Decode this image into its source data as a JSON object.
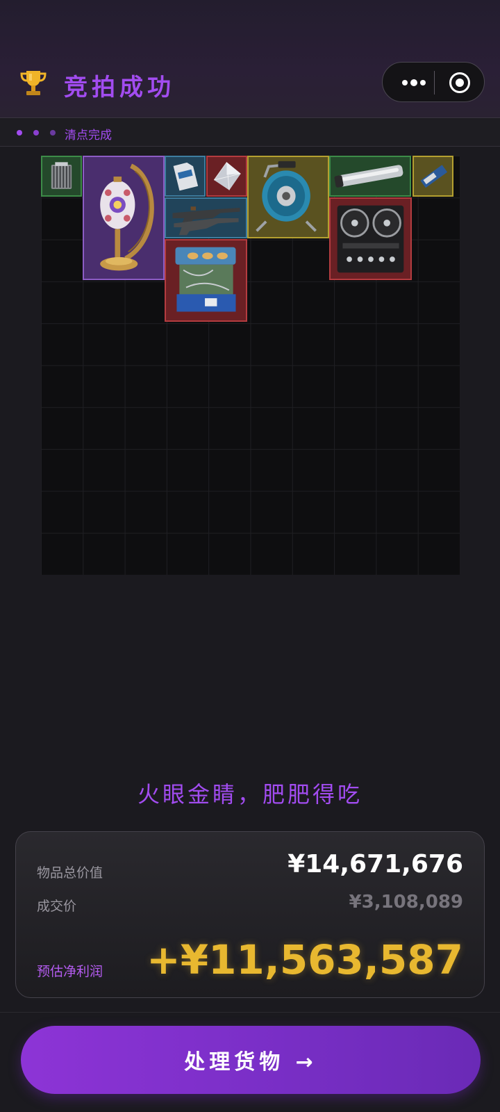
{
  "header": {
    "title": "竞拍成功",
    "trophy_icon": "trophy-icon",
    "more_icon": "more-dots-icon",
    "close_icon": "target-circle-icon"
  },
  "status": {
    "text": "清点完成"
  },
  "slogan": "火眼金睛，肥肥得吃",
  "summary": {
    "total_label": "物品总价值",
    "total_value": "¥14,671,676",
    "price_label": "成交价",
    "price_value": "¥3,108,089",
    "profit_label": "预估净利润",
    "profit_value": "+¥11,563,587"
  },
  "cta": {
    "label": "处理货物 →"
  },
  "colors": {
    "accent": "#a24cf0",
    "profit": "#e8b830",
    "background": "#1b1a1f"
  },
  "inventory": {
    "items": [
      {
        "name": "cpu-cooler-item",
        "icon": "cpu-cooler-icon",
        "rarity": "green"
      },
      {
        "name": "moon-lamp-item",
        "icon": "moon-lamp-icon",
        "rarity": "purple"
      },
      {
        "name": "sd-card-item",
        "icon": "sd-card-icon",
        "rarity": "blue"
      },
      {
        "name": "diamond-item",
        "icon": "diamond-icon",
        "rarity": "red"
      },
      {
        "name": "cable-reel-item",
        "icon": "cable-reel-icon",
        "rarity": "gold"
      },
      {
        "name": "glass-tube-item",
        "icon": "glass-tube-icon",
        "rarity": "green"
      },
      {
        "name": "ssd-item",
        "icon": "ssd-icon",
        "rarity": "gold"
      },
      {
        "name": "rifle-item",
        "icon": "rifle-icon",
        "rarity": "blue"
      },
      {
        "name": "reel-recorder-item",
        "icon": "reel-recorder-icon",
        "rarity": "red"
      },
      {
        "name": "engine-block-item",
        "icon": "engine-block-icon",
        "rarity": "red"
      }
    ]
  }
}
